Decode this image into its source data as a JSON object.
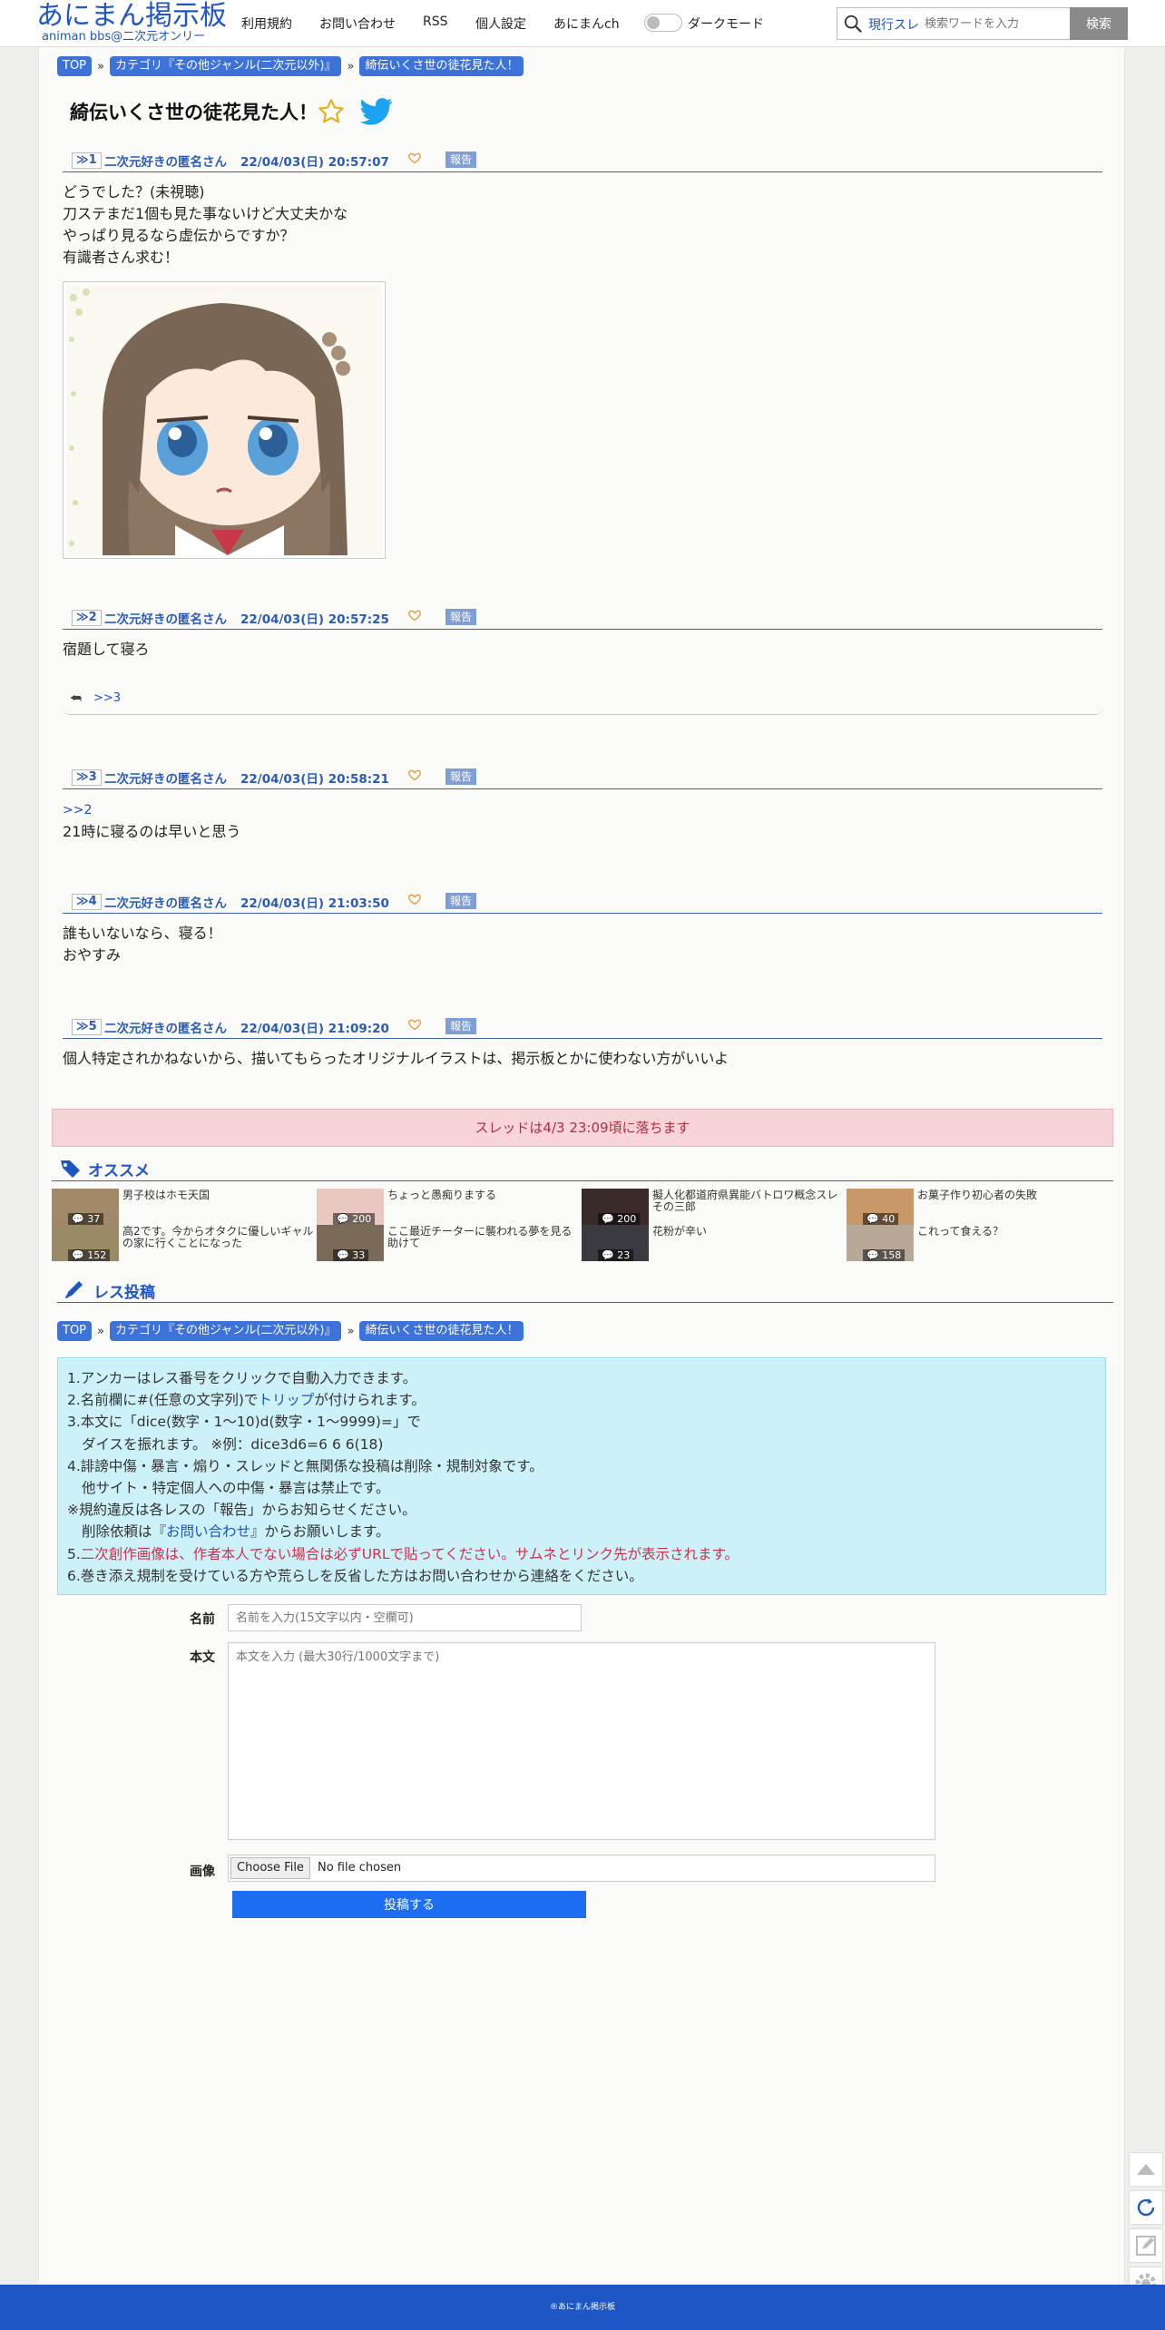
{
  "header": {
    "logo_main": "あにまん掲示板",
    "logo_sub": "animan bbs@二次元オンリー",
    "nav": [
      "利用規約",
      "お問い合わせ",
      "RSS",
      "個人設定",
      "あにまんch"
    ],
    "dark_mode_label": "ダークモード",
    "search_scope": "現行スレ",
    "search_placeholder": "検索ワードを入力",
    "search_button": "検索"
  },
  "breadcrumb": {
    "top": "TOP",
    "category": "カテゴリ『その他ジャンル(二次元以外)』",
    "thread": "綺伝いくさ世の徒花見た人！",
    "separator": "»"
  },
  "thread": {
    "title": "綺伝いくさ世の徒花見た人！"
  },
  "posts": [
    {
      "num": "≫1",
      "name": "二次元好きの匿名さん",
      "date": "22/04/03(日) 20:57:07",
      "report": "報告",
      "lines": [
        "どうでした？(未視聴)",
        "刀ステまだ1個も見た事ないけど大丈夫かな",
        "やっぱり見るなら虚伝からですか？",
        "有識者さん求む！"
      ]
    },
    {
      "num": "≫2",
      "name": "二次元好きの匿名さん",
      "date": "22/04/03(日) 20:57:25",
      "report": "報告",
      "lines": [
        "宿題して寝ろ"
      ],
      "reply": ">>3"
    },
    {
      "num": "≫3",
      "name": "二次元好きの匿名さん",
      "date": "22/04/03(日) 20:58:21",
      "report": "報告",
      "anchor": ">>2",
      "lines": [
        "21時に寝るのは早いと思う"
      ]
    },
    {
      "num": "≫4",
      "name": "二次元好きの匿名さん",
      "date": "22/04/03(日) 21:03:50",
      "report": "報告",
      "lines": [
        "誰もいないなら、寝る！",
        "おやすみ"
      ]
    },
    {
      "num": "≫5",
      "name": "二次元好きの匿名さん",
      "date": "22/04/03(日) 21:09:20",
      "report": "報告",
      "lines": [
        "個人特定されかねないから、描いてもらったオリジナルイラストは、掲示板とかに使わない方がいいよ"
      ]
    }
  ],
  "fall_notice": "スレッドは4/3 23:09頃に落ちます",
  "recommend": {
    "heading": "オススメ",
    "items": [
      {
        "text": "男子校はホモ天国",
        "count": "37",
        "color": "#a08868"
      },
      {
        "text": "ちょっと愚痴りまする",
        "count": "200",
        "color": "#e8c8c0"
      },
      {
        "text": "擬人化都道府県異能バトロワ概念スレその三郎",
        "count": "200",
        "color": "#3a2a2a"
      },
      {
        "text": "お菓子作り初心者の失敗",
        "count": "40",
        "color": "#c89868"
      },
      {
        "text": "高2です。今からオタクに優しいギャルの家に行くことになった",
        "count": "152",
        "color": "#9a8a68"
      },
      {
        "text": "ここ最近チーターに襲われる夢を見る助けて",
        "count": "33",
        "color": "#7a6a58"
      },
      {
        "text": "花粉が辛い",
        "count": "23",
        "color": "#3a3a40"
      },
      {
        "text": "これって食える？",
        "count": "158",
        "color": "#b8a898"
      }
    ]
  },
  "post_form": {
    "heading": "レス投稿",
    "rules": [
      {
        "text": "1.アンカーはレス番号をクリックで自動入力できます。"
      },
      {
        "pre": "2.名前欄に#(任意の文字列)で",
        "link": "トリップ",
        "post": "が付けられます。"
      },
      {
        "text": "3.本文に「dice(数字・1～10)d(数字・1～9999)=」で"
      },
      {
        "text": "ダイスを振れます。 ※例：dice3d6=6 6 6(18)",
        "indent": true
      },
      {
        "text": "4.誹謗中傷・暴言・煽り・スレッドと無関係な投稿は削除・規制対象です。"
      },
      {
        "text": "他サイト・特定個人への中傷・暴言は禁止です。",
        "indent": true
      },
      {
        "text": "※規約違反は各レスの「報告」からお知らせください。"
      },
      {
        "pre": "削除依頼は『",
        "link": "お問い合わせ",
        "post": "』からお願いします。",
        "indent": true
      },
      {
        "pre": "5.",
        "red": "二次創作画像は、作者本人でない場合は必ずURLで貼ってください。サムネとリンク先が表示されます。"
      },
      {
        "text": "6.巻き添え規制を受けている方や荒らしを反省した方はお問い合わせから連絡をください。"
      }
    ],
    "name_label": "名前",
    "name_placeholder": "名前を入力(15文字以内・空欄可)",
    "body_label": "本文",
    "body_placeholder": "本文を入力 (最大30行/1000文字まで)",
    "image_label": "画像",
    "file_button": "Choose File",
    "file_status": "No file chosen",
    "submit": "投稿する"
  },
  "footer": "®あにまん掲示板",
  "colors": {
    "accent": "#1f56c6",
    "report": "#7f9ed6",
    "notice_bg": "#f6d4d8",
    "rules_bg": "#cdf1f9"
  }
}
